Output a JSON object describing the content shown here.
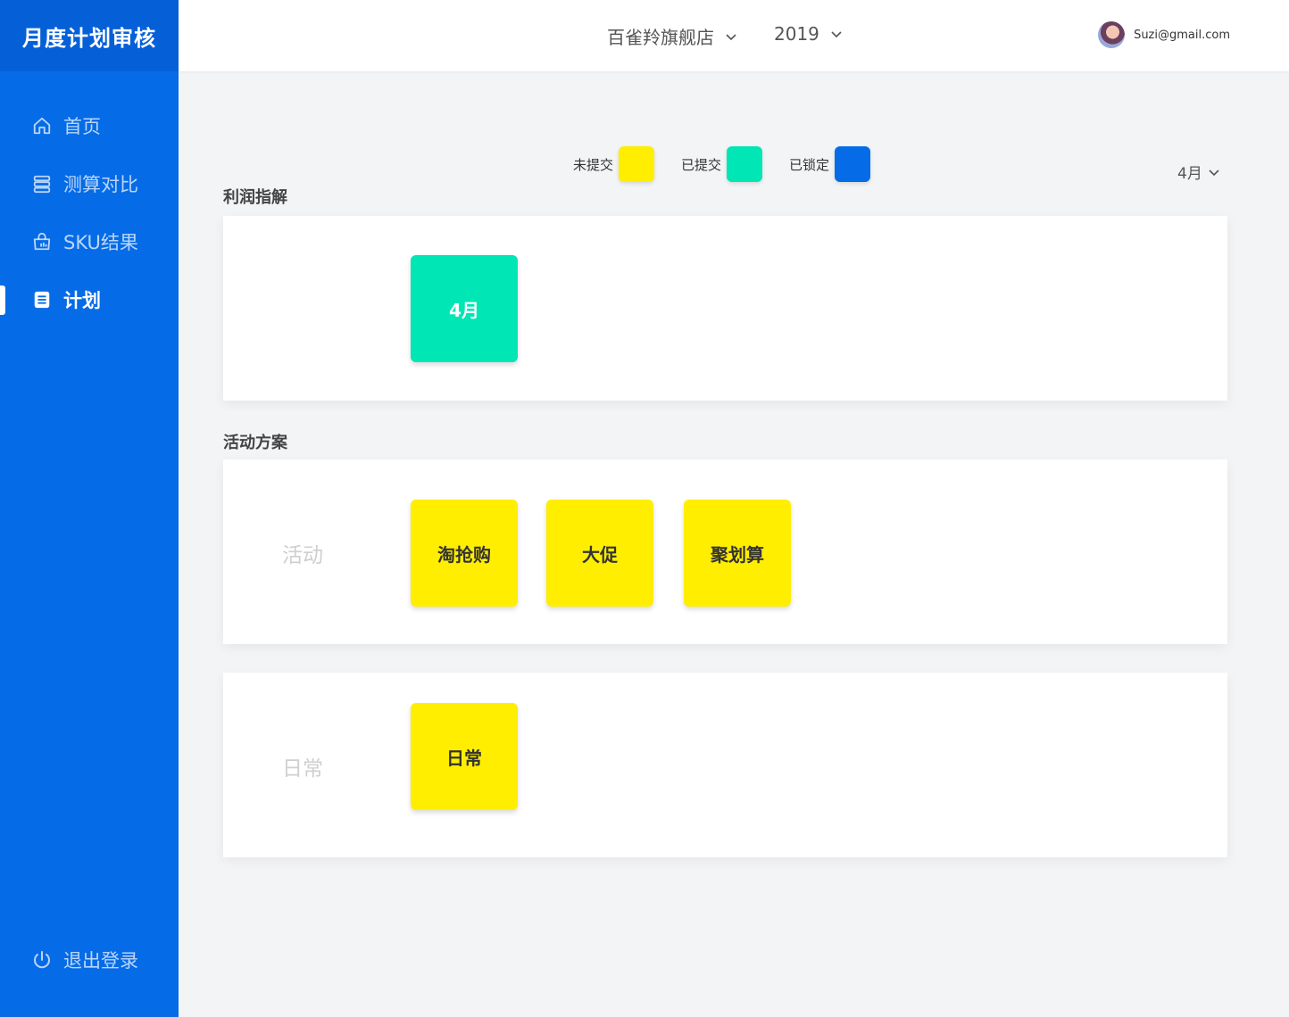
{
  "app": {
    "title": "月度计划审核"
  },
  "sidebar": {
    "items": [
      {
        "label": "首页",
        "icon": "home-icon",
        "active": false
      },
      {
        "label": "测算对比",
        "icon": "database-icon",
        "active": false
      },
      {
        "label": "SKU结果",
        "icon": "shopping-bag-icon",
        "active": false
      },
      {
        "label": "计划",
        "icon": "document-icon",
        "active": true
      }
    ],
    "logout": {
      "label": "退出登录",
      "icon": "power-icon"
    }
  },
  "header": {
    "store": {
      "value": "百雀羚旗舰店",
      "icon": "chevron-down-icon"
    },
    "year": {
      "value": "2019",
      "icon": "chevron-down-icon"
    },
    "user": {
      "email": "Suzi@gmail.com"
    }
  },
  "legend": {
    "items": [
      {
        "label": "未提交",
        "color": "#ffee00"
      },
      {
        "label": "已提交",
        "color": "#00e6b4"
      },
      {
        "label": "已锁定",
        "color": "#066be6"
      }
    ]
  },
  "month_select": {
    "value": "4月"
  },
  "sections": {
    "profit": {
      "title": "利润指解",
      "tiles": [
        {
          "label": "4月",
          "status": "已提交"
        }
      ]
    },
    "activity": {
      "title": "活动方案",
      "rows": [
        {
          "label": "活动",
          "tiles": [
            {
              "label": "淘抢购"
            },
            {
              "label": "大促"
            },
            {
              "label": "聚划算"
            }
          ]
        },
        {
          "label": "日常",
          "tiles": [
            {
              "label": "日常"
            }
          ]
        }
      ]
    }
  },
  "colors": {
    "sidebar": "#066be6",
    "submitted": "#00e6b4",
    "unsubmitted": "#ffee00",
    "locked": "#066be6"
  }
}
